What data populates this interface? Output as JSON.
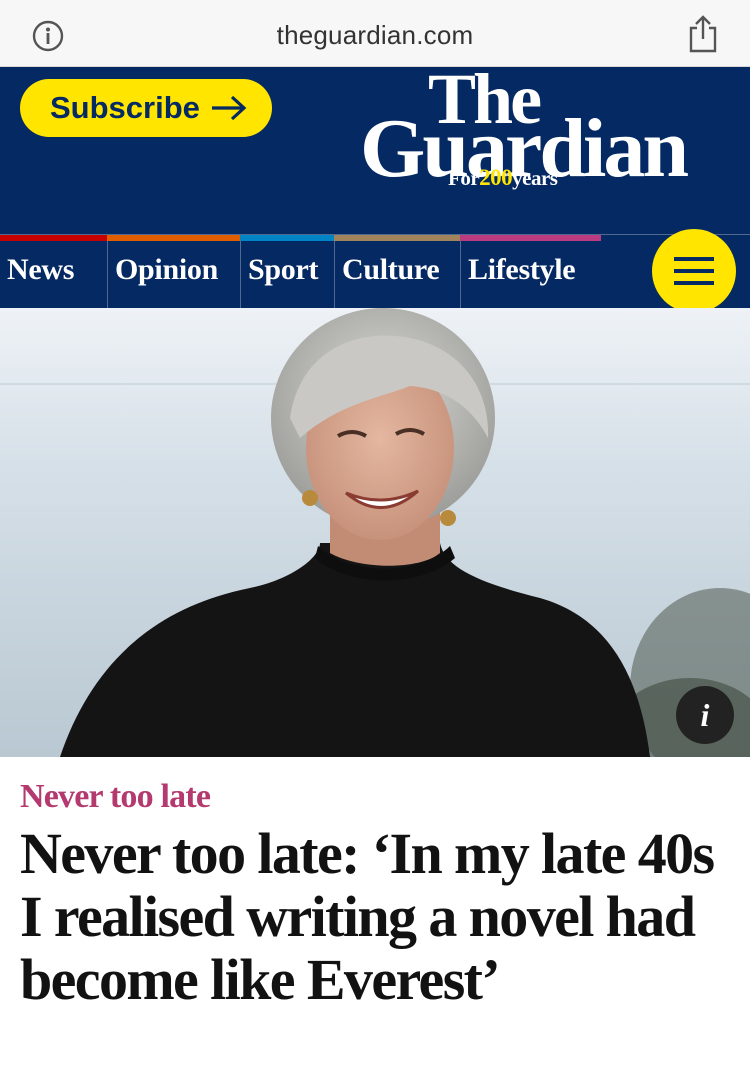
{
  "browser": {
    "url": "theguardian.com",
    "info_icon": "info-circle-icon",
    "share_icon": "share-icon"
  },
  "header": {
    "subscribe_label": "Subscribe",
    "logo_the": "The",
    "logo_guardian": "Guardian",
    "tagline_prefix": "For",
    "tagline_number": "200",
    "tagline_suffix": "years",
    "background_color": "#052962",
    "accent_yellow": "#ffe500"
  },
  "nav": {
    "items": [
      {
        "label": "News",
        "color": "#c70000"
      },
      {
        "label": "Opinion",
        "color": "#e05e00"
      },
      {
        "label": "Sport",
        "color": "#0084c6"
      },
      {
        "label": "Culture",
        "color": "#a1845c"
      },
      {
        "label": "Lifestyle",
        "color": "#bb3b80"
      }
    ],
    "menu_icon": "hamburger-menu-icon"
  },
  "hero": {
    "info_label": "i"
  },
  "article": {
    "kicker": "Never too late",
    "kicker_color": "#b3396e",
    "headline": "Never too late: ‘In my late 40s I realised writing a novel had become like Everest’"
  }
}
